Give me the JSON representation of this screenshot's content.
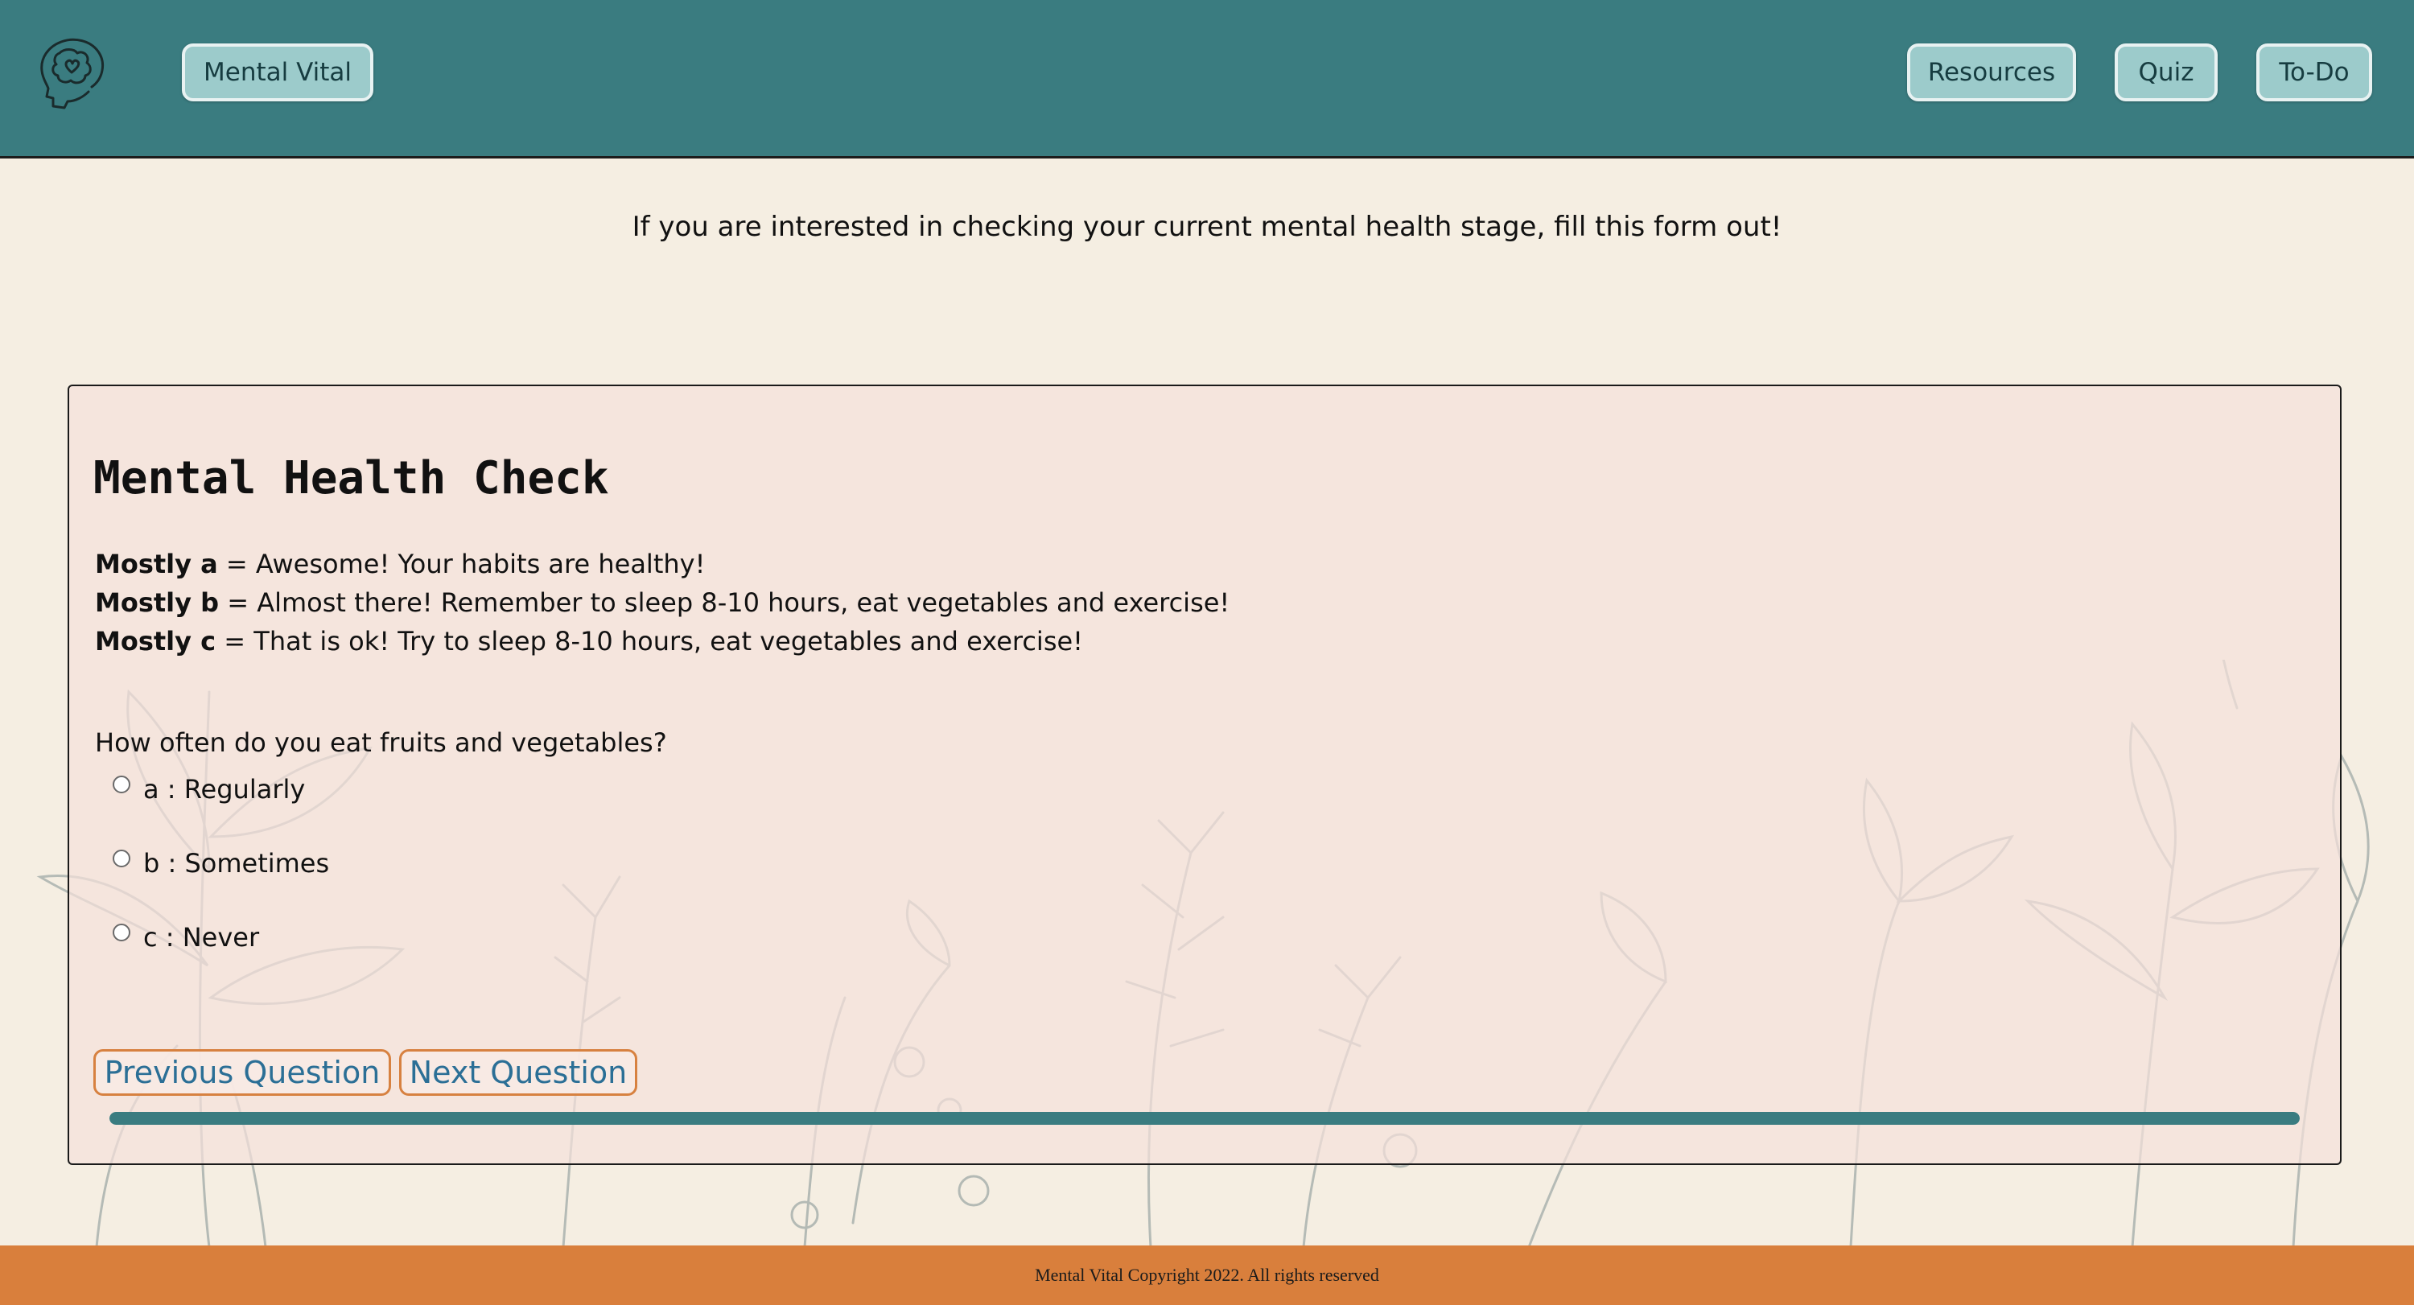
{
  "header": {
    "logo_icon": "brain-head-icon",
    "brand_label": "Mental Vital",
    "nav": {
      "resources": "Resources",
      "quiz": "Quiz",
      "todo": "To-Do"
    }
  },
  "intro_text": "If you are interested in checking your current mental health stage, fill this form out!",
  "quiz": {
    "title": "Mental Health Check",
    "legend": [
      {
        "key": "Mostly a",
        "text": "= Awesome! Your habits are healthy!"
      },
      {
        "key": "Mostly b",
        "text": "= Almost there! Remember to sleep 8-10 hours, eat vegetables and exercise!"
      },
      {
        "key": "Mostly c",
        "text": "= That is ok! Try to sleep 8-10 hours, eat vegetables and exercise!"
      }
    ],
    "question": "How often do you eat fruits and vegetables?",
    "options": [
      {
        "label": "a : Regularly",
        "selected": false
      },
      {
        "label": "b : Sometimes",
        "selected": false
      },
      {
        "label": "c : Never",
        "selected": false
      }
    ],
    "prev_label": "Previous Question",
    "next_label": "Next Question",
    "progress_percent": 100
  },
  "footer_text": "Mental Vital Copyright 2022. All rights reserved",
  "colors": {
    "header_bg": "#3a7c80",
    "nav_button_bg": "#9ccbcb",
    "page_bg": "#f5eee2",
    "card_bg": "#f5e1dc",
    "accent_orange": "#d97f3c",
    "button_text_blue": "#2b6f96"
  }
}
